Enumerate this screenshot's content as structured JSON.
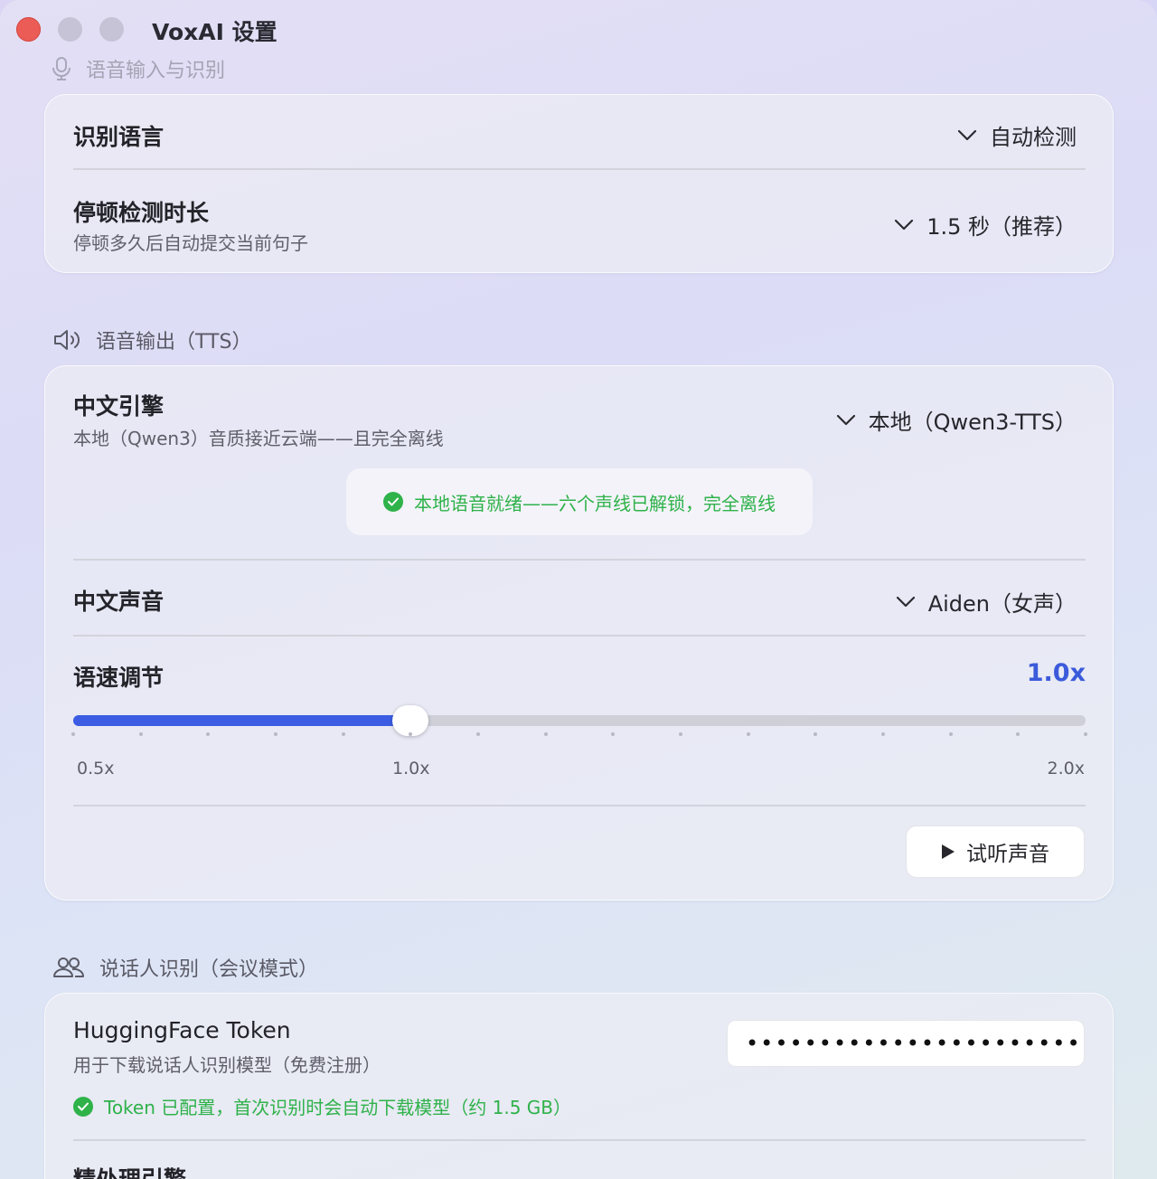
{
  "window": {
    "title": "VoxAI 设置"
  },
  "speech_input": {
    "heading": "语音输入与识别",
    "language": {
      "label": "识别语言",
      "value": "自动检测"
    },
    "pause": {
      "label": "停顿检测时长",
      "subtitle": "停顿多久后自动提交当前句子",
      "value": "1.5 秒（推荐）"
    }
  },
  "speech_output": {
    "heading": "语音输出（TTS）",
    "engine": {
      "label": "中文引擎",
      "subtitle": "本地（Qwen3）音质接近云端——且完全离线",
      "value": "本地（Qwen3-TTS）"
    },
    "ready_message": "本地语音就绪——六个声线已解锁，完全离线",
    "voice": {
      "label": "中文声音",
      "value": "Aiden（女声）"
    },
    "speed": {
      "label": "语速调节",
      "value_display": "1.0x",
      "min": 0.5,
      "max": 2.0,
      "value": 1.0,
      "step": 0.1,
      "tick_labels": [
        "0.5x",
        "1.0x",
        "2.0x"
      ]
    },
    "preview_button": "试听声音"
  },
  "diarization": {
    "heading": "说话人识别（会议模式）",
    "token": {
      "label": "HuggingFace Token",
      "subtitle": "用于下载说话人识别模型（免费注册）",
      "masked_value": "••••••••••••••••••••••••••••",
      "status": "Token 已配置，首次识别时会自动下载模型（约 1.5 GB）"
    },
    "next_row_label": "精处理引擎"
  },
  "colors": {
    "accent": "#3b5ce3",
    "success": "#2fb24a",
    "close": "#ec5c56"
  },
  "icons": [
    "microphone-icon",
    "speaker-icon",
    "people-icon",
    "chevron-down-icon",
    "checkmark-icon",
    "play-icon"
  ]
}
